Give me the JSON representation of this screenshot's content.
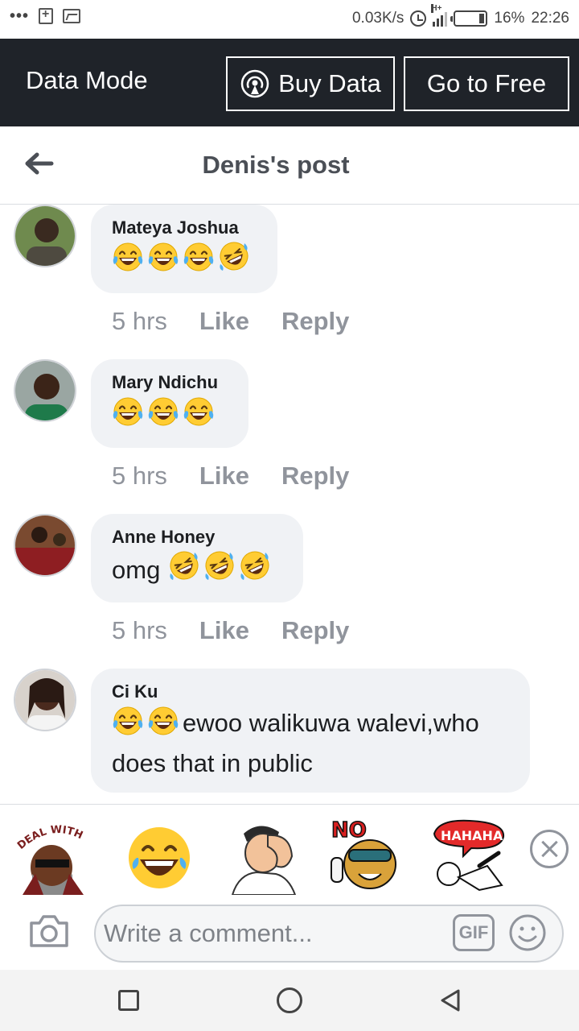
{
  "status_bar": {
    "network_speed": "0.03K/s",
    "network_type": "H+",
    "battery": "16%",
    "time": "22:26"
  },
  "data_mode": {
    "title": "Data Mode",
    "buy_label": "Buy Data",
    "free_label": "Go to Free"
  },
  "header": {
    "title": "Denis's post"
  },
  "comments": [
    {
      "name": "Mateya Joshua",
      "text": "",
      "emojis": [
        "joy",
        "joy",
        "joy",
        "rofl"
      ],
      "time": "5 hrs",
      "like": "Like",
      "reply": "Reply"
    },
    {
      "name": "Mary Ndichu",
      "text": "",
      "emojis": [
        "joy",
        "joy",
        "joy"
      ],
      "time": "5 hrs",
      "like": "Like",
      "reply": "Reply"
    },
    {
      "name": "Anne Honey",
      "text": "omg",
      "emojis": [
        "rofl",
        "rofl",
        "rofl"
      ],
      "time": "5 hrs",
      "like": "Like",
      "reply": "Reply"
    },
    {
      "name": "Ci Ku",
      "text": "ewoo walikuwa walevi,who does that in public",
      "emojis": [
        "joy",
        "joy"
      ],
      "time": "",
      "like": "",
      "reply": ""
    }
  ],
  "stickers": [
    {
      "icon": "deal-with-it-sticker",
      "caption": "DEAL WITH IT"
    },
    {
      "icon": "laughing-emoji-sticker",
      "caption": ""
    },
    {
      "icon": "facepalm-sticker",
      "caption": ""
    },
    {
      "icon": "no-cat-sticker",
      "caption": "NO"
    },
    {
      "icon": "hahaha-sticker",
      "caption": "HAHAHA"
    }
  ],
  "composer": {
    "placeholder": "Write a comment...",
    "gif_label": "GIF"
  },
  "colors": {
    "data_bar": "#1f2329",
    "bubble": "#f0f2f5",
    "meta_text": "#90949c",
    "header_text": "#4b4f56"
  }
}
